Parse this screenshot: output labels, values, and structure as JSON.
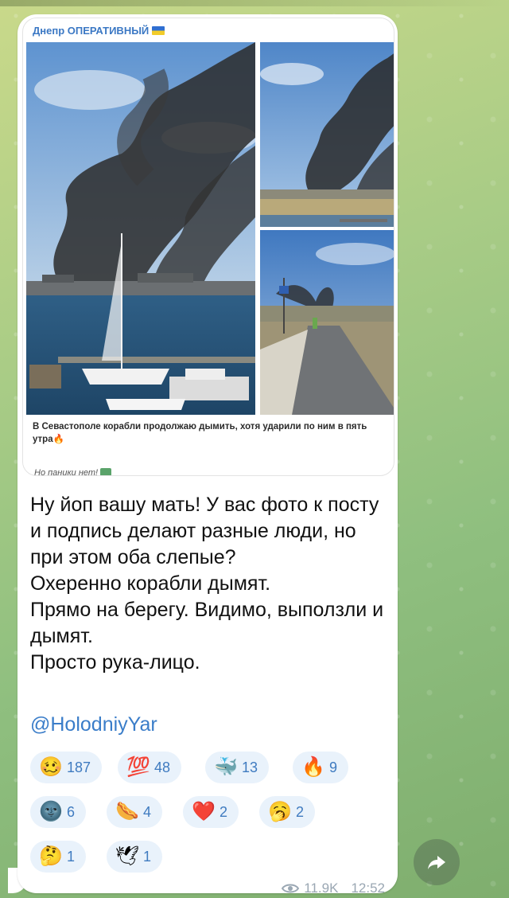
{
  "embed": {
    "channel": "Днепр ОПЕРАТИВНЫЙ",
    "caption": "В Севастополе корабли продолжаю дымить, хотя ударили по ним в пять утра🔥",
    "note": "Но паники нет!"
  },
  "message": {
    "text": "Ну йоп вашу мать! У вас фото к посту и подпись делают разные люди, но при этом оба слепые?\nОхеренно корабли дымят.\nПрямо на берегу. Видимо, выползли и дымят.\nПросто рука-лицо.",
    "mention": "@HolodniyYar"
  },
  "reactions": [
    {
      "emoji": "🥴",
      "count": "187"
    },
    {
      "emoji": "💯",
      "count": "48"
    },
    {
      "emoji": "🐳",
      "count": "13"
    },
    {
      "emoji": "🔥",
      "count": "9"
    },
    {
      "emoji": "🌚",
      "count": "6"
    },
    {
      "emoji": "🌭",
      "count": "4"
    },
    {
      "emoji": "❤️",
      "count": "2"
    },
    {
      "emoji": "🥱",
      "count": "2"
    },
    {
      "emoji": "🤔",
      "count": "1"
    },
    {
      "emoji": "🕊",
      "count": "1"
    }
  ],
  "meta": {
    "views": "11.9K",
    "time": "12:52"
  },
  "icons": {
    "views": "eye-icon",
    "share": "share-arrow-icon"
  }
}
